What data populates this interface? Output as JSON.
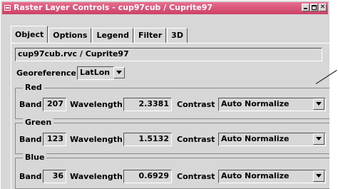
{
  "window": {
    "title": "Raster Layer Controls - cup97cub / Cuprite97",
    "close_glyph": "✕"
  },
  "tabs": [
    {
      "label": "Object",
      "active": true
    },
    {
      "label": "Options"
    },
    {
      "label": "Legend"
    },
    {
      "label": "Filter"
    },
    {
      "label": "3D"
    }
  ],
  "object": {
    "path_value": "cup97cub.rvc / Cuprite97",
    "georeference_label": "Georeference",
    "georeference_value": "LatLon"
  },
  "bands": [
    {
      "group": "Red",
      "band_label": "Band",
      "band": "207",
      "wavelength_label": "Wavelength",
      "wavelength": "2.3381",
      "contrast_label": "Contrast",
      "contrast": "Auto Normalize"
    },
    {
      "group": "Green",
      "band_label": "Band",
      "band": "123",
      "wavelength_label": "Wavelength",
      "wavelength": "1.5132",
      "contrast_label": "Contrast",
      "contrast": "Auto Normalize"
    },
    {
      "group": "Blue",
      "band_label": "Band",
      "band": "36",
      "wavelength_label": "Wavelength",
      "wavelength": "0.6929",
      "contrast_label": "Contrast",
      "contrast": "Auto Normalize"
    }
  ],
  "colors": {
    "titlebar": "#d94f75",
    "window_bg": "#d7d7d7"
  }
}
